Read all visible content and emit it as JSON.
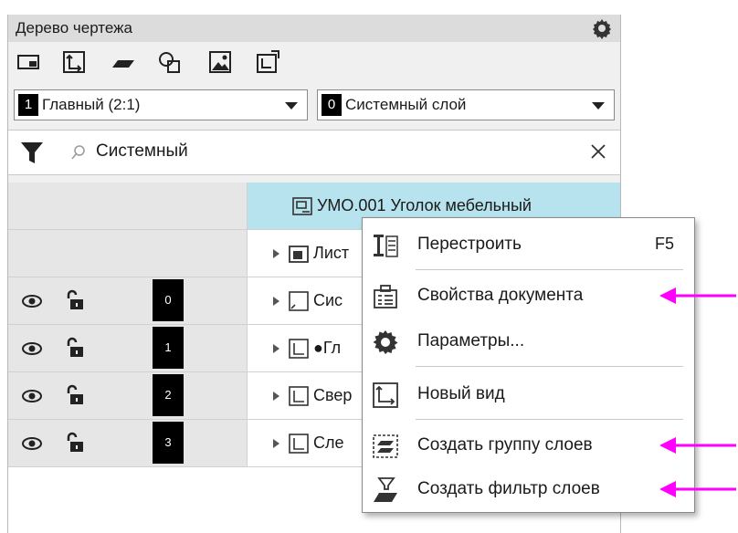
{
  "panel": {
    "title": "Дерево чертежа",
    "toolbar_icons": [
      "new-view-icon",
      "local-cs-icon",
      "line-icon",
      "shapes-icon",
      "image-icon",
      "projection-view-icon"
    ]
  },
  "view_selector": {
    "number": "1",
    "value": "Главный (2:1)"
  },
  "layer_selector": {
    "number": "0",
    "value": "Системный слой"
  },
  "filter": {
    "search_value": "Системный"
  },
  "tree": {
    "document": "УМО.001 Уголок мебельный",
    "sheets": "Лист",
    "layers": [
      {
        "number": "0",
        "label": "Сис"
      },
      {
        "number": "1",
        "label": "●Гл"
      },
      {
        "number": "2",
        "label": "Свер"
      },
      {
        "number": "3",
        "label": "Сле"
      }
    ]
  },
  "context_menu": {
    "items": [
      {
        "label": "Перестроить",
        "shortcut": "F5",
        "icon": "rebuild-icon"
      },
      {
        "label": "Свойства документа",
        "icon": "document-properties-icon"
      },
      {
        "label": "Параметры...",
        "icon": "settings-gear-icon"
      },
      {
        "label": "Новый вид",
        "icon": "new-view-icon"
      },
      {
        "label": "Создать группу слоев",
        "icon": "layer-group-icon"
      },
      {
        "label": "Создать фильтр слоев",
        "icon": "layer-filter-icon"
      }
    ]
  },
  "colors": {
    "highlight": "#b6e3ed",
    "annotation_arrow": "#ff00ff"
  }
}
